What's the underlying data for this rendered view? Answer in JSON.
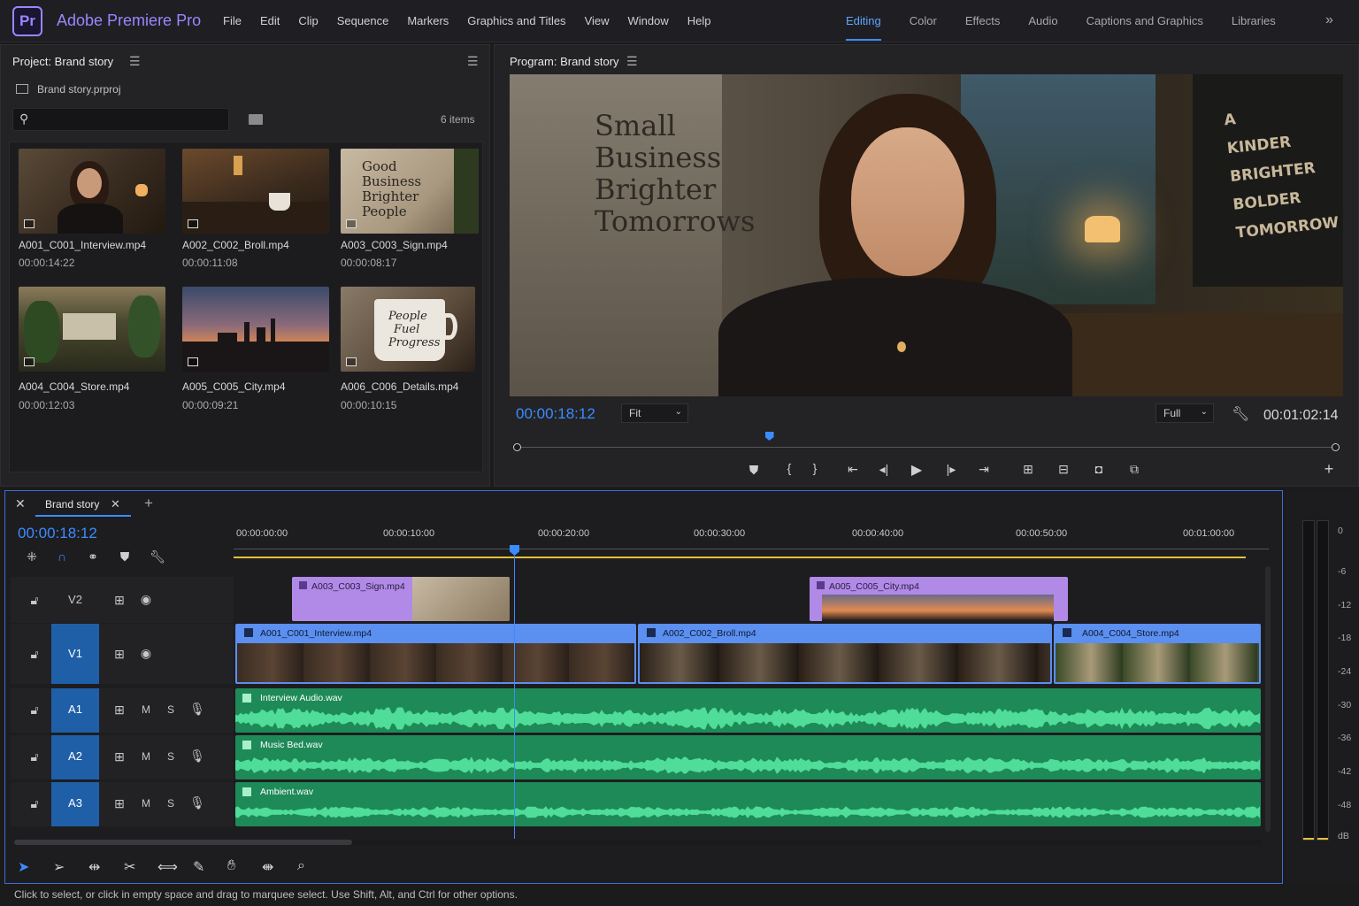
{
  "app": {
    "logo": "Pr",
    "name": "Adobe Premiere Pro"
  },
  "menus": [
    "File",
    "Edit",
    "Clip",
    "Sequence",
    "Markers",
    "Graphics and Titles",
    "View",
    "Window",
    "Help"
  ],
  "workspaces": [
    "Editing",
    "Color",
    "Effects",
    "Audio",
    "Captions and Graphics",
    "Libraries"
  ],
  "active_workspace": "Editing",
  "project": {
    "title": "Project: Brand story",
    "file": "Brand story.prproj",
    "search_value": "",
    "items_count": "6 items",
    "clips": [
      {
        "name": "A001_C001_Interview.mp4",
        "duration": "00:00:14:22"
      },
      {
        "name": "A002_C002_Broll.mp4",
        "duration": "00:00:11:08"
      },
      {
        "name": "A003_C003_Sign.mp4",
        "duration": "00:00:08:17"
      },
      {
        "name": "A004_C004_Store.mp4",
        "duration": "00:00:12:03"
      },
      {
        "name": "A005_C005_City.mp4",
        "duration": "00:00:09:21"
      },
      {
        "name": "A006_C006_Details.mp4",
        "duration": "00:00:10:15"
      }
    ]
  },
  "program": {
    "title": "Program: Brand story",
    "timecode": "00:00:18:12",
    "zoom": "Fit",
    "resolution": "Full",
    "duration": "00:01:02:14",
    "wall_left": [
      "Small",
      "Business",
      "Brighter",
      "Tomorrows"
    ],
    "wall_right": [
      "A",
      "KINDER",
      "BRIGHTER",
      "BOLDER",
      "TOMORROW"
    ],
    "playhead_fraction": 0.31
  },
  "timeline": {
    "tab": "Brand story",
    "timecode": "00:00:18:12",
    "ruler": [
      "00:00:00:00",
      "00:00:10:00",
      "00:00:20:00",
      "00:00:30:00",
      "00:00:40:00",
      "00:00:50:00",
      "00:01:00:00"
    ],
    "tracks": {
      "v2": "V2",
      "v1": "V1",
      "a1": "A1",
      "a2": "A2",
      "a3": "A3",
      "m": "M",
      "s": "S"
    },
    "clips": {
      "v2_1": "A003_C003_Sign.mp4",
      "v2_2": "A005_C005_City.mp4",
      "v1_1": "A001_C001_Interview.mp4",
      "v1_2": "A002_C002_Broll.mp4",
      "v1_3": "A004_C004_Store.mp4",
      "a1": "Interview Audio.wav",
      "a2": "Music Bed.wav",
      "a3": "Ambient.wav"
    }
  },
  "thumb_text": {
    "sign": [
      "Good",
      "Business",
      "Brighter",
      "People"
    ],
    "mug": [
      "People",
      "Fuel",
      "Progress"
    ]
  },
  "meter": [
    "0",
    "-6",
    "-12",
    "-18",
    "-24",
    "-30",
    "-36",
    "-42",
    "-48",
    "dB"
  ],
  "status": "Click to select, or click in empty space and drag to marquee select. Use Shift, Alt, and Ctrl for other options.",
  "colors": {
    "accent": "#3b8cff",
    "brand": "#9a86ff",
    "audio": "#1e8a58",
    "video": "#5b8ff0",
    "graphic": "#b08ae6"
  }
}
